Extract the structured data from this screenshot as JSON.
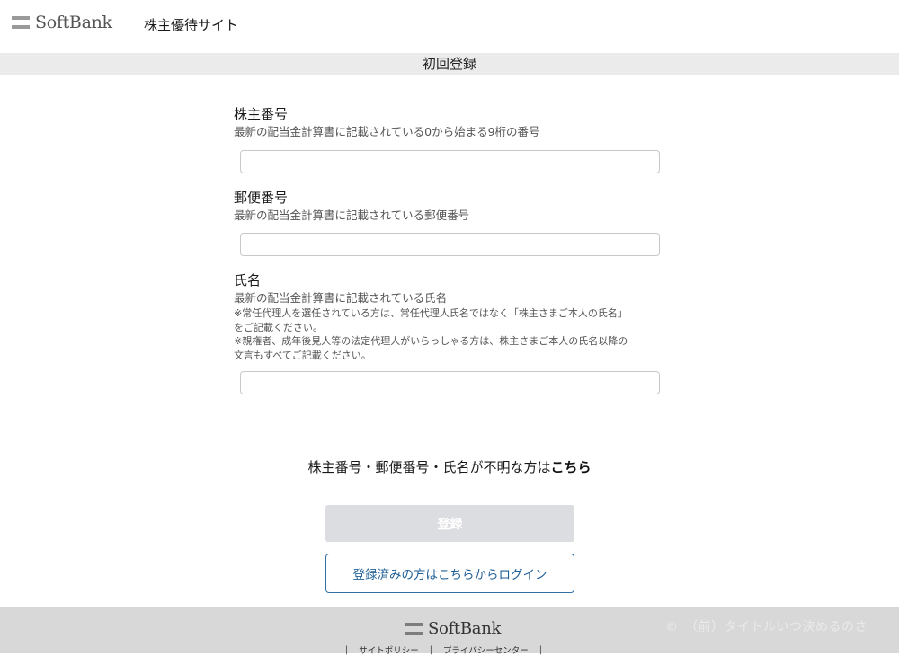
{
  "header": {
    "logo_text": "SoftBank",
    "site_title": "株主優待サイト"
  },
  "page": {
    "title": "初回登録"
  },
  "form": {
    "shareholder_number": {
      "label": "株主番号",
      "description": "最新の配当金計算書に記載されている0から始まる9桁の番号",
      "value": "",
      "placeholder": ""
    },
    "postal_code": {
      "label": "郵便番号",
      "description": "最新の配当金計算書に記載されている郵便番号",
      "value": "",
      "placeholder": ""
    },
    "name": {
      "label": "氏名",
      "description": "最新の配当金計算書に記載されている氏名",
      "note_1": "※常任代理人を選任されている方は、常任代理人氏名ではなく「株主さまご本人の氏名」",
      "note_1b": "をご記載ください。",
      "note_2": "※親権者、成年後見人等の法定代理人がいらっしゃる方は、株主さまご本人の氏名以降の",
      "note_2b": "文言もすべてご記載ください。",
      "value": "",
      "placeholder": ""
    }
  },
  "help": {
    "text": "株主番号・郵便番号・氏名が不明な方は",
    "link": "こちら"
  },
  "buttons": {
    "register": "登録",
    "login": "登録済みの方はこちらからログイン"
  },
  "footer": {
    "logo_text": "SoftBank",
    "links": [
      "サイトポリシー",
      "プライバシーセンター"
    ],
    "watermark": "©　（前）タイトルいつ決めるのさ"
  }
}
